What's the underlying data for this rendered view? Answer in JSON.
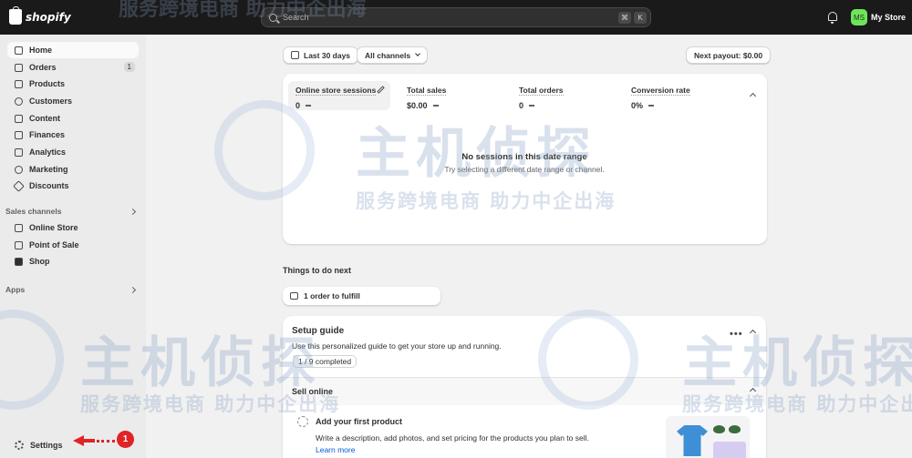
{
  "topbar": {
    "logo_text": "shopify",
    "search_placeholder": "Search",
    "shortcut_keys": [
      "⌘",
      "K"
    ],
    "avatar_initials": "MS",
    "store_name": "My Store"
  },
  "sidebar": {
    "items": [
      {
        "label": "Home"
      },
      {
        "label": "Orders",
        "badge": "1"
      },
      {
        "label": "Products"
      },
      {
        "label": "Customers"
      },
      {
        "label": "Content"
      },
      {
        "label": "Finances"
      },
      {
        "label": "Analytics"
      },
      {
        "label": "Marketing"
      },
      {
        "label": "Discounts"
      }
    ],
    "sales_channels_label": "Sales channels",
    "channels": [
      {
        "label": "Online Store"
      },
      {
        "label": "Point of Sale"
      },
      {
        "label": "Shop"
      }
    ],
    "apps_label": "Apps",
    "settings_label": "Settings"
  },
  "annotation": {
    "step": "1"
  },
  "filters": {
    "date_range": "Last 30 days",
    "channels": "All channels",
    "payout": "Next payout: $0.00"
  },
  "metrics": [
    {
      "label": "Online store sessions",
      "value": "0"
    },
    {
      "label": "Total sales",
      "value": "$0.00"
    },
    {
      "label": "Total orders",
      "value": "0"
    },
    {
      "label": "Conversion rate",
      "value": "0%"
    }
  ],
  "empty_state": {
    "title": "No sessions in this date range",
    "subtitle": "Try selecting a different date range or channel."
  },
  "todo": {
    "title": "Things to do next",
    "fulfill_label": "1 order to fulfill"
  },
  "setup_guide": {
    "title": "Setup guide",
    "description": "Use this personalized guide to get your store up and running.",
    "progress": "1 / 9 completed",
    "section_label": "Sell online",
    "task_title": "Add your first product",
    "task_desc": "Write a description, add photos, and set pricing for the products you plan to sell.",
    "learn_more": "Learn more"
  },
  "watermark": {
    "brand": "主机侦探",
    "slogan": "服务跨境电商 助力中企出海"
  },
  "colors": {
    "topbar": "#1a1a1a",
    "sidebar": "#ebebeb",
    "annotation": "#e02424",
    "link": "#005bd3"
  }
}
